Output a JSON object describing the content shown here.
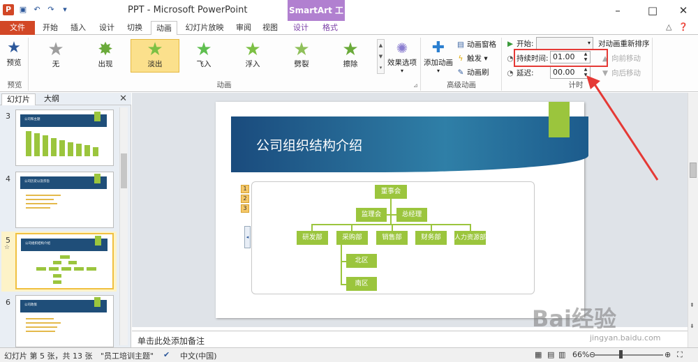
{
  "window": {
    "title": "PPT - Microsoft PowerPoint",
    "context_group": "SmartArt 工具",
    "controls": [
      "–",
      "□",
      "✕"
    ]
  },
  "qat": {
    "logo": "P",
    "icons": [
      "save-icon",
      "undo-icon",
      "redo-icon"
    ]
  },
  "tabs": [
    "文件",
    "开始",
    "插入",
    "设计",
    "切换",
    "动画",
    "幻灯片放映",
    "审阅",
    "视图",
    "设计",
    "格式"
  ],
  "ribbon": {
    "preview": {
      "label": "预览",
      "group": "预览"
    },
    "animations": [
      {
        "label": "无",
        "color": "#9e9e9e"
      },
      {
        "label": "出现",
        "color": "#6aaa3a"
      },
      {
        "label": "淡出",
        "color": "#7cc044",
        "selected": true
      },
      {
        "label": "飞入",
        "color": "#5fbf50"
      },
      {
        "label": "浮入",
        "color": "#7cc044"
      },
      {
        "label": "劈裂",
        "color": "#8fc05a"
      },
      {
        "label": "擦除",
        "color": "#6aaa3a"
      }
    ],
    "animation_group": "动画",
    "effect_options": "效果选项",
    "add_animation": "添加动画",
    "advanced": {
      "pane": "动画窗格",
      "trigger": "触发",
      "painter": "动画刷",
      "group": "高级动画"
    },
    "timing": {
      "start_label": "开始:",
      "start_value": "",
      "duration_label": "持续时间:",
      "duration_value": "01.00",
      "delay_label": "延迟:",
      "delay_value": "00.00",
      "reorder": "对动画重新排序",
      "move_earlier": "向前移动",
      "move_later": "向后移动",
      "group": "计时"
    }
  },
  "panel": {
    "tab_slides": "幻灯片",
    "tab_outline": "大纲",
    "thumbs": [
      {
        "num": "3",
        "title": "公司和主题"
      },
      {
        "num": "4",
        "title": "公司历史以及宗旨"
      },
      {
        "num": "5",
        "title": "公司组织结构介绍"
      },
      {
        "num": "6",
        "title": "公司政策"
      }
    ]
  },
  "slide": {
    "title": "公司组织结构介绍",
    "org": {
      "board": "董事会",
      "supervisory": "监理会",
      "gm": "总经理",
      "departments": [
        "研发部",
        "采购部",
        "销售部",
        "财务部",
        "人力资源部"
      ],
      "sub": [
        "北区",
        "南区"
      ]
    },
    "anim_tags": [
      "1",
      "2",
      "3"
    ]
  },
  "notes_placeholder": "单击此处添加备注",
  "status": {
    "slide_info": "幻灯片 第 5 张，共 13 张",
    "theme": "\"员工培训主题\"",
    "language": "中文(中国)",
    "zoom": "66%"
  },
  "watermark": {
    "text": "Bai经验",
    "sub": "jingyan.baidu.com"
  }
}
